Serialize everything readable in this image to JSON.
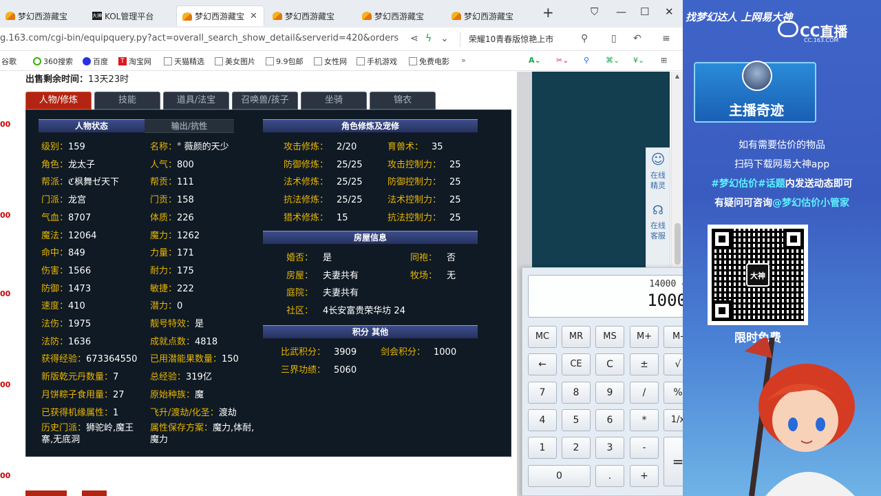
{
  "browser": {
    "tabs": [
      {
        "label": "梦幻西游藏宝",
        "icon": "dh-icon",
        "active": false
      },
      {
        "label": "KOL管理平台",
        "icon": "kol-icon",
        "active": false
      },
      {
        "label": "梦幻西游藏宝",
        "icon": "dh-icon",
        "active": true
      },
      {
        "label": "梦幻西游藏宝",
        "icon": "dh-icon",
        "active": false
      },
      {
        "label": "梦幻西游藏宝",
        "icon": "dh-icon",
        "active": false
      },
      {
        "label": "梦幻西游藏宝",
        "icon": "dh-icon",
        "active": false
      }
    ],
    "url": "g.163.com/cgi-bin/equipquery.py?act=overall_search_show_detail&serverid=420&orders",
    "search_text": "荣耀10青春版惊艳上市",
    "bookmarks": [
      "谷歌",
      "360搜索",
      "百度",
      "淘宝网",
      "天猫精选",
      "美女图片",
      "9.9包邮",
      "女性网",
      "手机游戏",
      "免费电影"
    ]
  },
  "page": {
    "sale_time_label": "出售剩余时间：",
    "sale_time_value": "13天23时",
    "tabs": [
      "人物/修炼",
      "技能",
      "道具/法宝",
      "召唤兽/孩子",
      "坐骑",
      "锦衣"
    ],
    "section_status": "人物状态",
    "section_output": "输出/抗性",
    "section_cultivation": "角色修炼及宠修",
    "section_house": "房屋信息",
    "section_points": "积分 其他",
    "left_col": [
      {
        "k": "级别：",
        "v": "159"
      },
      {
        "k": "角色：",
        "v": "龙太子"
      },
      {
        "k": "帮派：",
        "v": "ℭ枫舞ゼ天下"
      },
      {
        "k": "门派：",
        "v": "龙宫"
      },
      {
        "k": "气血：",
        "v": "8707"
      },
      {
        "k": "魔法：",
        "v": "12064"
      },
      {
        "k": "命中：",
        "v": "849"
      },
      {
        "k": "伤害：",
        "v": "1566"
      },
      {
        "k": "防御：",
        "v": "1473"
      },
      {
        "k": "速度：",
        "v": "410"
      },
      {
        "k": "法伤：",
        "v": "1975"
      },
      {
        "k": "法防：",
        "v": "1636"
      },
      {
        "k": "获得经验：",
        "v": "673364550"
      },
      {
        "k": "新版乾元丹数量：",
        "v": "7"
      },
      {
        "k": "月饼粽子食用量：",
        "v": "27"
      },
      {
        "k": "已获得机缘属性：",
        "v": "1"
      },
      {
        "k": "历史门派：",
        "v": "狮驼岭,魔王寨,无底洞"
      }
    ],
    "mid_col": [
      {
        "k": "名称：",
        "v": "° 薇颜的天少"
      },
      {
        "k": "人气：",
        "v": "800"
      },
      {
        "k": "帮贡：",
        "v": "111"
      },
      {
        "k": "门贡：",
        "v": "158"
      },
      {
        "k": "体质：",
        "v": "226"
      },
      {
        "k": "魔力：",
        "v": "1262"
      },
      {
        "k": "力量：",
        "v": "171"
      },
      {
        "k": "耐力：",
        "v": "175"
      },
      {
        "k": "敏捷：",
        "v": "222"
      },
      {
        "k": "潜力：",
        "v": "0"
      },
      {
        "k": "靓号特效：",
        "v": "是"
      },
      {
        "k": "成就点数：",
        "v": "4818"
      },
      {
        "k": "已用潜能果数量：",
        "v": "150"
      },
      {
        "k": "总经验：",
        "v": "319亿"
      },
      {
        "k": "原始种族：",
        "v": "魔"
      },
      {
        "k": "飞升/渡劫/化圣：",
        "v": "渡劫"
      },
      {
        "k": "属性保存方案：",
        "v": "魔力,体耐,魔力"
      }
    ],
    "cultivation": [
      {
        "k": "攻击修炼：",
        "v": "2/20",
        "k2": "育兽术：",
        "v2": "35"
      },
      {
        "k": "防御修炼：",
        "v": "25/25",
        "k2": "攻击控制力：",
        "v2": "25"
      },
      {
        "k": "法术修炼：",
        "v": "25/25",
        "k2": "防御控制力：",
        "v2": "25"
      },
      {
        "k": "抗法修炼：",
        "v": "25/25",
        "k2": "法术控制力：",
        "v2": "25"
      },
      {
        "k": "猎术修炼：",
        "v": "15",
        "k2": "抗法控制力：",
        "v2": "25"
      }
    ],
    "house": {
      "married_label": "婚否：",
      "married": "是",
      "together_label": "同袍：",
      "together": "否",
      "house_label": "房屋：",
      "house": "夫妻共有",
      "pasture_label": "牧场：",
      "pasture": "无",
      "yard_label": "庭院：",
      "yard": "夫妻共有",
      "community_label": "社区：",
      "community": "4长安富贵荣华坊 24"
    },
    "points": {
      "pk_label": "比武积分：",
      "pk": "3909",
      "sword_label": "剑会积分：",
      "sword": "1000",
      "merit_label": "三界功绩：",
      "merit": "5060"
    },
    "helper": {
      "online_spirit": "在线精灵",
      "online_service": "在线客服"
    }
  },
  "calculator": {
    "expression": "14000 +",
    "display": "1000",
    "keys": [
      "MC",
      "MR",
      "MS",
      "M+",
      "M-",
      "←",
      "CE",
      "C",
      "±",
      "√",
      "7",
      "8",
      "9",
      "/",
      "%",
      "4",
      "5",
      "6",
      "*",
      "1/x",
      "1",
      "2",
      "3",
      "-",
      "=",
      "0",
      ".",
      "+"
    ]
  },
  "overlay": {
    "slogan": "找梦幻达人 上网易大神",
    "brand": "CC直播",
    "domain": "CC.163.COM",
    "host_title": "主播奇迹",
    "line1": "如有需要估价的物品",
    "line2": "扫码下载网易大神app",
    "line3_a": "#梦幻估价#话题",
    "line3_b": "内发送动态即可",
    "line4_a": "有疑问可咨询",
    "line4_b": "@梦幻估价小管家",
    "qr_center": "大神",
    "qr_free": "限时免费"
  }
}
